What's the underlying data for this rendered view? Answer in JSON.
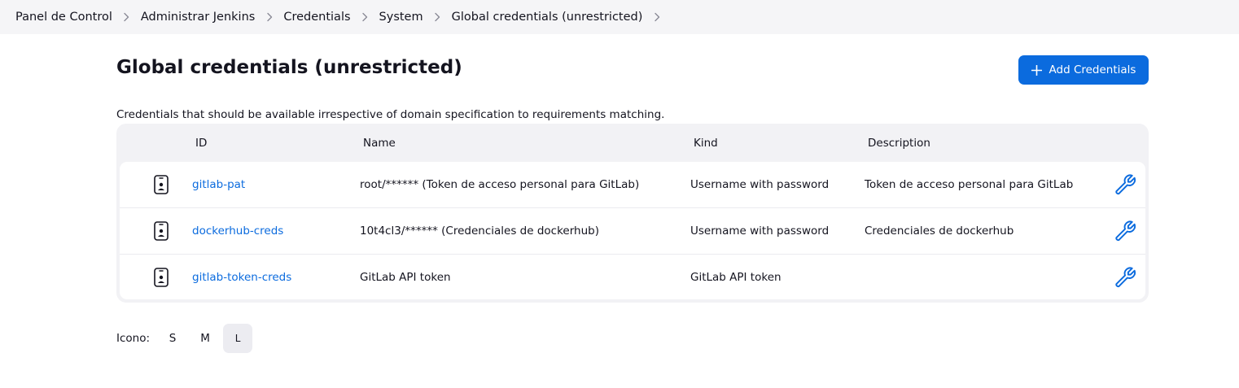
{
  "breadcrumb": [
    {
      "label": "Panel de Control"
    },
    {
      "label": "Administrar Jenkins"
    },
    {
      "label": "Credentials"
    },
    {
      "label": "System"
    },
    {
      "label": "Global credentials (unrestricted)"
    }
  ],
  "header": {
    "title": "Global credentials (unrestricted)",
    "add_button_label": "Add Credentials"
  },
  "description": "Credentials that should be available irrespective of domain specification to requirements matching.",
  "table": {
    "columns": {
      "id": "ID",
      "name": "Name",
      "kind": "Kind",
      "description": "Description"
    },
    "rows": [
      {
        "id": "gitlab-pat",
        "name": "root/****** (Token de acceso personal para GitLab)",
        "kind": "Username with password",
        "description": "Token de acceso personal para GitLab"
      },
      {
        "id": "dockerhub-creds",
        "name": "10t4cl3/****** (Credenciales de dockerhub)",
        "kind": "Username with password",
        "description": "Credenciales de dockerhub"
      },
      {
        "id": "gitlab-token-creds",
        "name": "GitLab API token",
        "kind": "GitLab API token",
        "description": ""
      }
    ]
  },
  "icon_size": {
    "label": "Icono:",
    "options": [
      "S",
      "M",
      "L"
    ],
    "selected": "L"
  },
  "colors": {
    "accent": "#0b6bde",
    "breadcrumb_bg": "#f5f5f7",
    "table_bg": "#f2f2f5"
  },
  "icons": {
    "row": "credential-phone-icon",
    "configure": "wrench-icon",
    "add": "plus-icon",
    "separator": "chevron-right-icon"
  }
}
